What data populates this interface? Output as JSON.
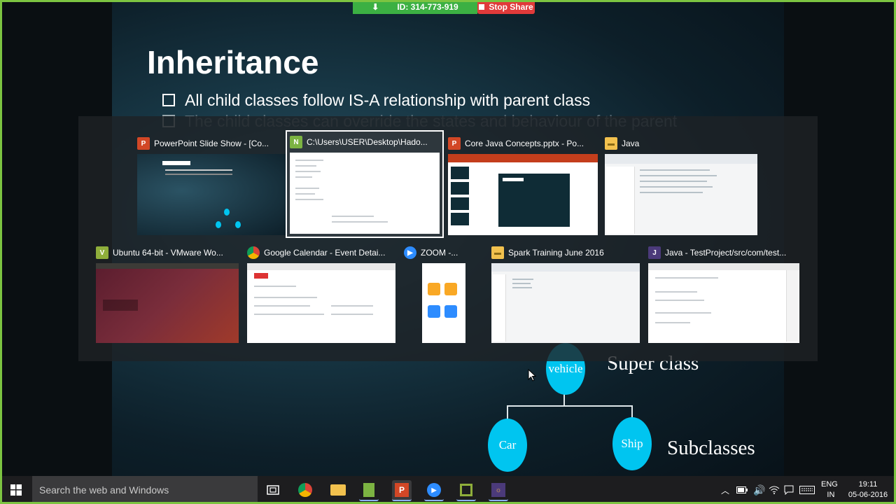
{
  "share": {
    "id_label": "ID: 314-773-919",
    "stop_label": "Stop Share"
  },
  "slide": {
    "title": "Inheritance",
    "bullets": [
      "All child classes follow IS-A relationship with parent class",
      "The child classes can override the states and behaviour of the parent"
    ],
    "diagram": {
      "root": "vehicle",
      "children": [
        "Car",
        "Ship"
      ],
      "super_label": "Super class",
      "sub_label": "Subclasses"
    }
  },
  "switcher": {
    "row1": [
      {
        "title": "PowerPoint Slide Show - [Co...",
        "icon": "powerpoint-icon"
      },
      {
        "title": "C:\\Users\\USER\\Desktop\\Hado...",
        "icon": "notepad-plus-icon"
      },
      {
        "title": "Core Java Concepts.pptx - Po...",
        "icon": "powerpoint-icon"
      },
      {
        "title": "Java",
        "icon": "folder-icon"
      }
    ],
    "row2": [
      {
        "title": "Ubuntu 64-bit - VMware Wo...",
        "icon": "vmware-icon"
      },
      {
        "title": "Google Calendar - Event Detai...",
        "icon": "chrome-icon"
      },
      {
        "title": "ZOOM -...",
        "icon": "zoom-icon"
      },
      {
        "title": "Spark Training June 2016",
        "icon": "folder-icon"
      },
      {
        "title": "Java - TestProject/src/com/test...",
        "icon": "eclipse-icon"
      }
    ]
  },
  "taskbar": {
    "search_placeholder": "Search the web and Windows",
    "language": "ENG",
    "region": "IN",
    "time": "19:11",
    "date": "05-06-2016"
  }
}
